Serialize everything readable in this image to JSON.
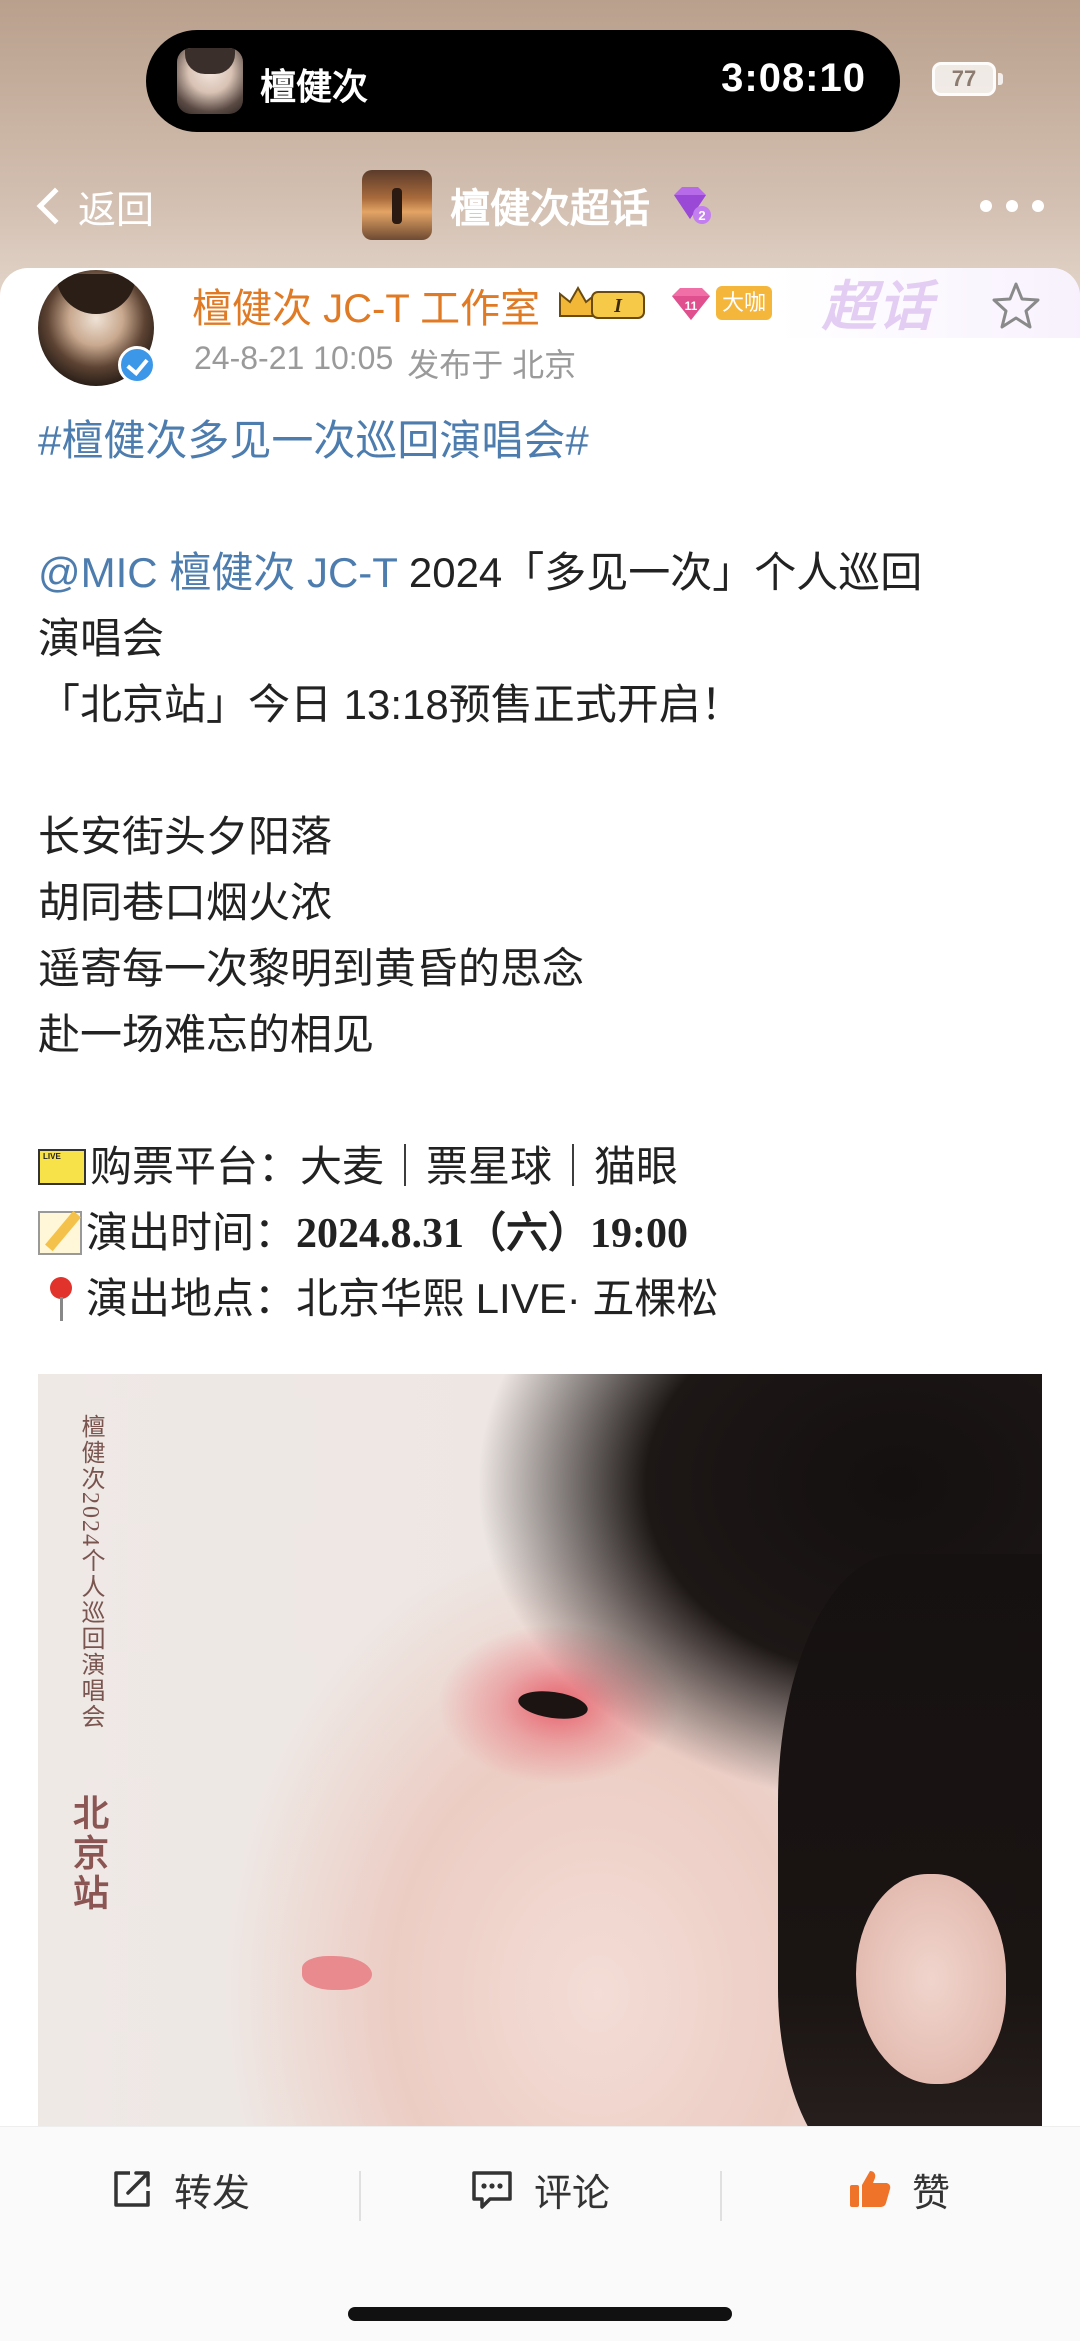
{
  "live_activity": {
    "name": "檀健次",
    "timer": "3:08:10",
    "battery": "77"
  },
  "nav": {
    "back_label": "返回",
    "title": "檀健次超话",
    "watermark": "超话"
  },
  "post": {
    "author": "檀健次 JC-T 工作室",
    "badge_level": "I",
    "badge_daka": "大咖",
    "date": "24-8-21 10:05",
    "location": "发布于 北京",
    "hashtag": "#檀健次多见一次巡回演唱会#",
    "mention": "@MIC 檀健次 JC-T",
    "line1_rest": " 2024「多见一次」个人巡回",
    "line2": "演唱会",
    "line3": "「北京站」今日 13:18预售正式开启！",
    "poem": [
      "长安街头夕阳落",
      "胡同巷口烟火浓",
      "遥寄每一次黎明到黄昏的思念",
      "赴一场难忘的相见"
    ],
    "ticket_label": "购票平台：",
    "ticket_value": "大麦｜票星球｜猫眼",
    "time_label": "演出时间：",
    "time_value": "2024.8.31（六）19:00",
    "venue_label": "演出地点：",
    "venue_value": "北京华熙 LIVE· 五棵松",
    "poster_text": "檀健次2024个人巡回演唱会",
    "poster_city": "北京站"
  },
  "actions": {
    "repost": "转发",
    "comment": "评论",
    "like": "赞"
  },
  "colors": {
    "author_orange": "#e07a25",
    "link_blue": "#4d7cae",
    "like_orange": "#f0732a"
  }
}
